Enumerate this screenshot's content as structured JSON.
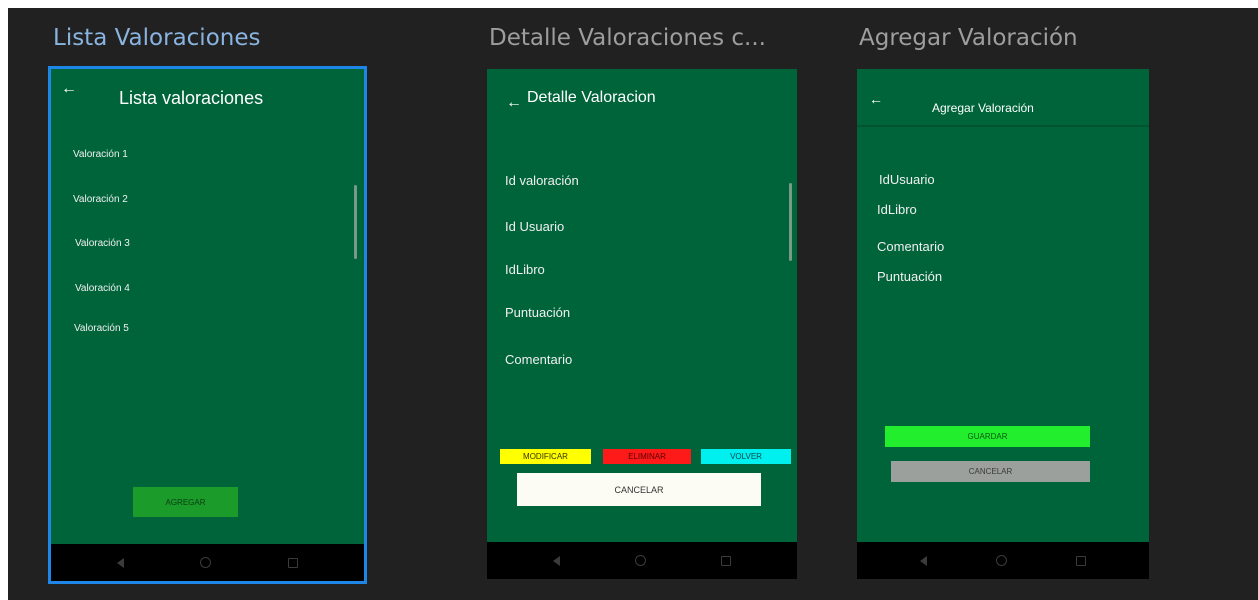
{
  "screens": [
    {
      "title": "Lista Valoraciones",
      "appbar_title": "Lista valoraciones",
      "items": [
        "Valoración 1",
        "Valoración 2",
        "Valoración 3",
        "Valoración 4",
        "Valoración 5"
      ],
      "add_button": "AGREGAR"
    },
    {
      "title": "Detalle Valoraciones c...",
      "appbar_title": "Detalle Valoracion",
      "fields": [
        "Id valoración",
        "Id Usuario",
        "IdLibro",
        "Puntuación",
        "Comentario"
      ],
      "buttons": {
        "modify": "MODIFICAR",
        "delete": "ELIMINAR",
        "back": "VOLVER",
        "cancel": "CANCELAR"
      }
    },
    {
      "title": "Agregar Valoración",
      "appbar_title": "Agregar Valoración",
      "fields": [
        "IdUsuario",
        "IdLibro",
        "Comentario",
        "Puntuación"
      ],
      "buttons": {
        "save": "GUARDAR",
        "cancel": "CANCELAR"
      }
    }
  ],
  "icons": {
    "back": "arrow-left-icon",
    "nav_back": "triangle-back-icon",
    "nav_home": "circle-home-icon",
    "nav_recent": "square-recent-icon"
  },
  "colors": {
    "workspace_bg": "#212121",
    "phone_bg": "#00643a",
    "navbar_bg": "#000000",
    "selection": "#1e86e6",
    "title_selected": "#8ab4e0",
    "title_default": "#9e9e9e",
    "add_button": "#1a9b2a",
    "modify_button": "#ffff00",
    "delete_button": "#ff1a1a",
    "back_button": "#00f0f0",
    "cancel_button_white": "#fcfcf5",
    "save_button": "#22ee2e",
    "cancel_button_gray": "#9ba09c"
  },
  "selected_screen": "Lista Valoraciones"
}
